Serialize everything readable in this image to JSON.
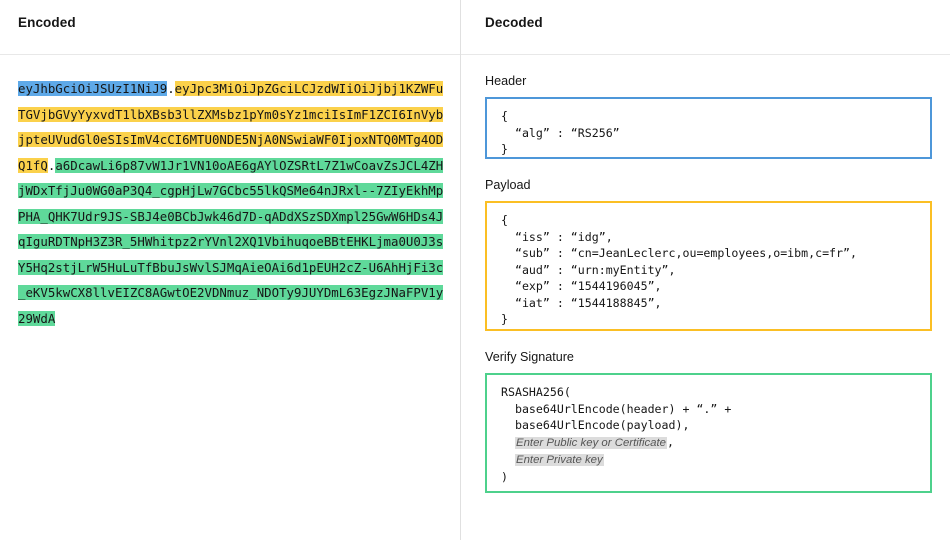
{
  "panes": {
    "encoded": {
      "title": "Encoded",
      "token": {
        "header": "eyJhbGciOiJSUzI1NiJ9",
        "separator1": ".",
        "payload": "eyJpc3MiOiJpZGciLCJzdWIiOiJjbj1KZWFuTGVjbGVyYyxvdT1lbXBsb3llZXMsbz1pYm0sYz1mciIsImF1ZCI6InVybjpteUVudGl0eSIsImV4cCI6MTU0NDE5NjA0NSwiaWF0IjoxNTQ0MTg4ODQ1fQ",
        "separator2": ".",
        "signature": "a6DcawLi6p87vW1Jr1VN10oAE6gAYlOZSRtL7Z1wCoavZsJCL4ZHjWDxTfjJu0WG0aP3Q4_cgpHjLw7GCbc55lkQSMe64nJRxl--7ZIyEkhMpPHA_QHK7Udr9JS-SBJ4e0BCbJwk46d7D-qADdXSzSDXmpl25GwW6HDs4JqIguRDTNpH3Z3R_5HWhitpz2rYVnl2XQ1VbihuqoeBBtEHKLjma0U0J3sY5Hq2stjLrW5HuLuTfBbuJsWvlSJMqAieOAi6d1pEUH2cZ-U6AhHjFi3c_eKV5kwCX8llvEIZC8AGwtOE2VDNmuz_NDOTy9JUYDmL63EgzJNaFPV1y29WdA"
      }
    },
    "decoded": {
      "title": "Decoded",
      "sections": [
        {
          "label": "Header",
          "accent": "#4e97d9",
          "code": "{\n  “alg” : “RS256”\n}"
        },
        {
          "label": "Payload",
          "accent": "#fbbf24",
          "code": "{\n  “iss” : “idg”,\n  “sub” : “cn=JeanLeclerc,ou=employees,o=ibm,c=fr”,\n  “aud” : “urn:myEntity”,\n  “exp” : “1544196045”,\n  “iat” : “1544188845”,\n}"
        },
        {
          "label": "Verify Signature",
          "accent": "#4ed18c",
          "code_line1": "RSASHA256(",
          "code_line2": "  base64UrlEncode(header) + “.” +",
          "code_line3": "  base64UrlEncode(payload),",
          "placeholder_public": "Enter Public key or Certificate",
          "comma_after_public": ",",
          "placeholder_private": "Enter Private key",
          "code_line_close": ")"
        }
      ]
    }
  },
  "colors": {
    "header_highlight": "#5ea9e8",
    "payload_highlight": "#fbd14b",
    "signature_highlight": "#5fd99a",
    "divider": "#e0e0e0",
    "placeholder_bg": "#dcdcdc"
  }
}
